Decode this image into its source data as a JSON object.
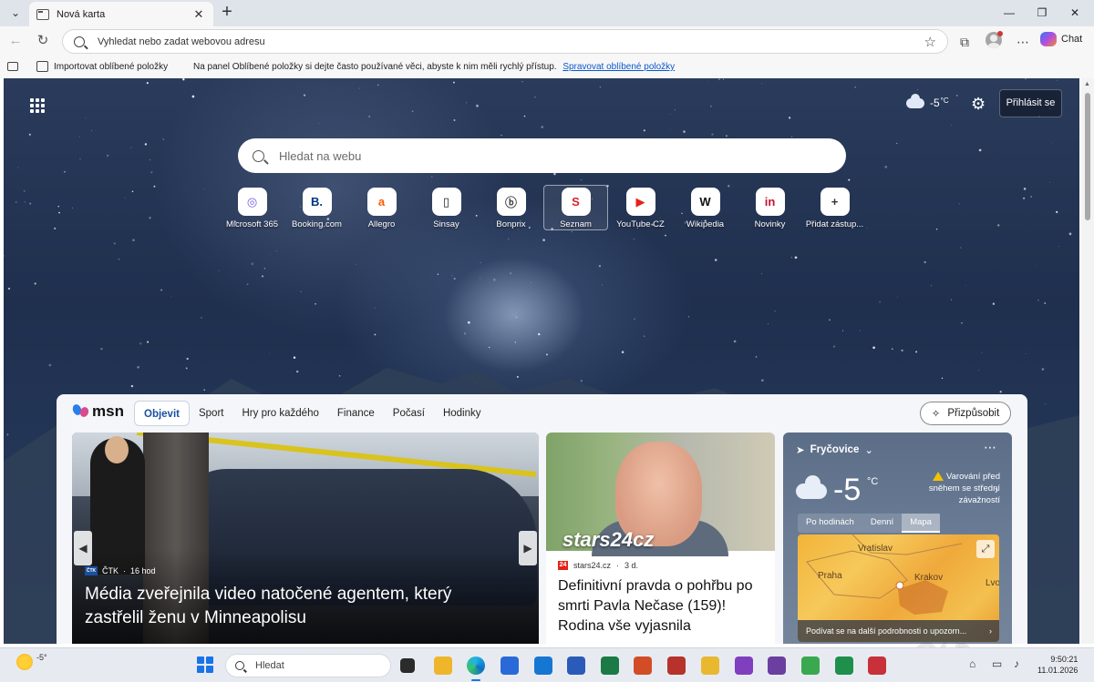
{
  "browser": {
    "tab_title": "Nová karta",
    "address_placeholder": "Vyhledat nebo zadat webovou adresu",
    "copilot_label": "Chat"
  },
  "favorites_bar": {
    "import_label": "Importovat oblíbené položky",
    "message": "Na panel Oblíbené položky si dejte často používané věci, abyste k nim měli rychlý přístup.",
    "manage_link": "Spravovat oblíbené položky"
  },
  "newtab": {
    "weather_temp": "-5",
    "weather_unit": "°C",
    "signin_label": "Přihlásit se",
    "search_placeholder": "Hledat na webu",
    "quick_links": [
      {
        "label": "Microsoft 365",
        "glyph": "◎",
        "color": "#6b5ce7"
      },
      {
        "label": "Booking.com",
        "glyph": "B.",
        "color": "#003580"
      },
      {
        "label": "Allegro",
        "glyph": "a",
        "color": "#ff5a00"
      },
      {
        "label": "Sinsay",
        "glyph": "▯",
        "color": "#222222"
      },
      {
        "label": "Bonprix",
        "glyph": "ⓑ",
        "color": "#444444"
      },
      {
        "label": "Seznam",
        "glyph": "S",
        "color": "#d8232a"
      },
      {
        "label": "YouTube CZ",
        "glyph": "▶",
        "color": "#e62117"
      },
      {
        "label": "Wikipedia",
        "glyph": "W",
        "color": "#111111"
      },
      {
        "label": "Novinky",
        "glyph": "in",
        "color": "#c4122f"
      },
      {
        "label": "Přidat zástup...",
        "glyph": "+",
        "color": "#333333"
      }
    ]
  },
  "feed": {
    "logo": "msn",
    "tabs": [
      "Objevit",
      "Sport",
      "Hry pro každého",
      "Finance",
      "Počasí",
      "Hodinky"
    ],
    "active_tab": "Objevit",
    "customize_label": "Přizpůsobit",
    "hero": {
      "source_logo": "ČTK",
      "source": "ČTK",
      "age": "16 hod",
      "title": "Média zveřejnila video natočené agentem, který zastřelil ženu v Minneapolisu"
    },
    "news": {
      "watermark": "stars24cz",
      "source_logo": "24",
      "source": "stars24.cz",
      "age": "3 d.",
      "title": "Definitivní pravda o pohřbu po smrti Pavla Nečase (159)! Rodina vše vyjasnila"
    },
    "weather": {
      "location": "Fryčovice",
      "temp": "-5",
      "unit": "°C",
      "warning": "Varování před sněhem se střední závažností",
      "tabs": [
        "Po hodinách",
        "Denní",
        "Mapa"
      ],
      "active_tab": "Mapa",
      "map_labels": [
        "Vratislav",
        "Praha",
        "Krakov",
        "Lvo"
      ],
      "map_footer": "Podívat se na další podrobnosti o upozorn..."
    }
  },
  "taskbar": {
    "weather_temp": "-5°",
    "search_placeholder": "Hledat",
    "time": "9:50:21",
    "date": "11.01.2026"
  },
  "watermark": "@( Bazos.cz"
}
